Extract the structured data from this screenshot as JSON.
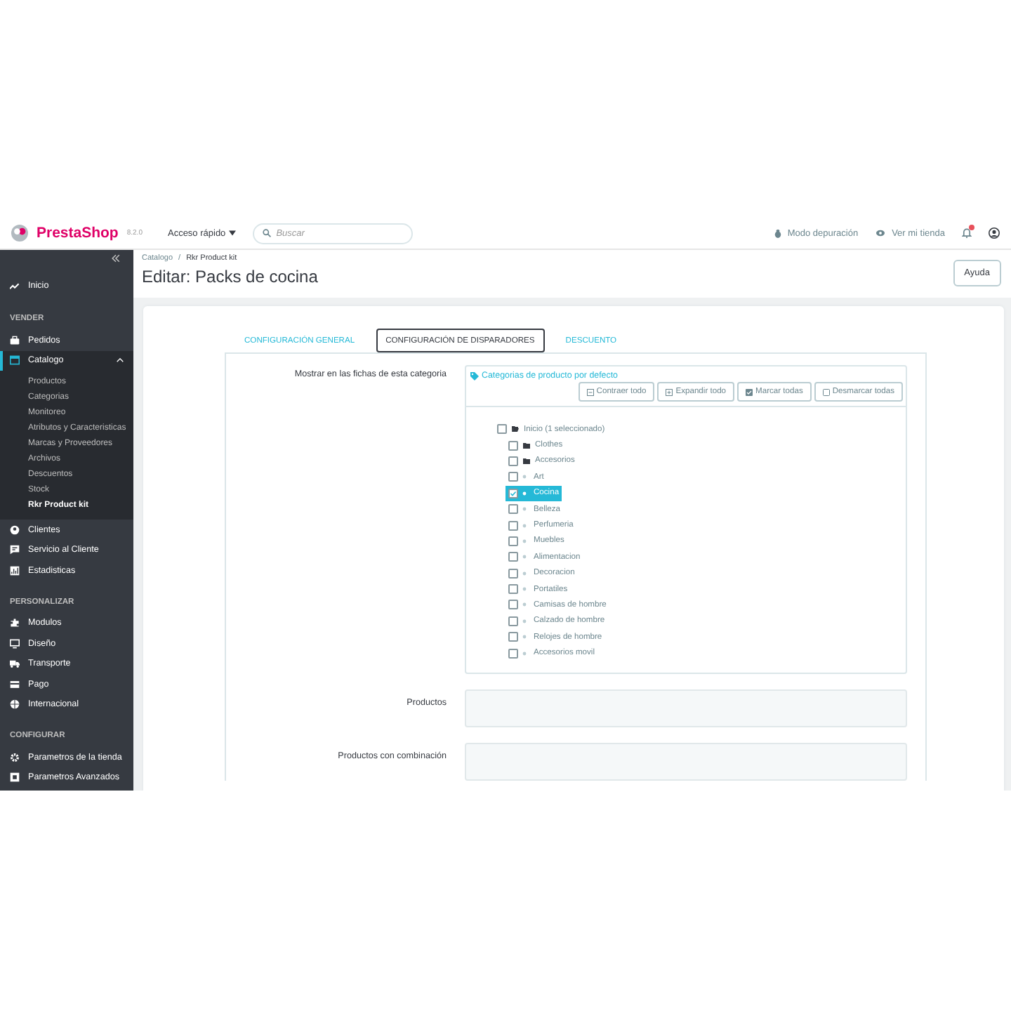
{
  "header": {
    "logo": "PrestaShop",
    "version": "8.2.0",
    "quick_access": "Acceso rápido",
    "search": {
      "placeholder": "Buscar"
    },
    "debug": "Modo depuración",
    "view_shop": "Ver mi tienda",
    "notifications": {
      "unread": true
    }
  },
  "sidebar": {
    "items": [
      {
        "kind": "link",
        "label": "Inicio",
        "selected": false
      },
      {
        "kind": "section",
        "label": "VENDER"
      },
      {
        "kind": "link",
        "label": "Pedidos",
        "selected": false
      },
      {
        "kind": "link",
        "label": "Catalogo",
        "selected": true,
        "expanded": true,
        "children": [
          {
            "label": "Productos",
            "selected": false
          },
          {
            "label": "Categorias",
            "selected": false
          },
          {
            "label": "Monitoreo",
            "selected": false
          },
          {
            "label": "Atributos y Caracteristicas",
            "selected": false
          },
          {
            "label": "Marcas y Proveedores",
            "selected": false
          },
          {
            "label": "Archivos",
            "selected": false
          },
          {
            "label": "Descuentos",
            "selected": false
          },
          {
            "label": "Stock",
            "selected": false
          },
          {
            "label": "Rkr Product kit",
            "selected": true
          }
        ]
      },
      {
        "kind": "link",
        "label": "Clientes",
        "selected": false
      },
      {
        "kind": "link",
        "label": "Servicio al Cliente",
        "selected": false
      },
      {
        "kind": "link",
        "label": "Estadisticas",
        "selected": false
      },
      {
        "kind": "section",
        "label": "PERSONALIZAR"
      },
      {
        "kind": "link",
        "label": "Modulos",
        "selected": false
      },
      {
        "kind": "link",
        "label": "Diseño",
        "selected": false
      },
      {
        "kind": "link",
        "label": "Transporte",
        "selected": false
      },
      {
        "kind": "link",
        "label": "Pago",
        "selected": false
      },
      {
        "kind": "link",
        "label": "Internacional",
        "selected": false
      },
      {
        "kind": "section",
        "label": "CONFIGURAR"
      },
      {
        "kind": "link",
        "label": "Parametros de la tienda",
        "selected": false
      },
      {
        "kind": "link",
        "label": "Parametros Avanzados",
        "selected": false
      }
    ]
  },
  "breadcrumb": {
    "items": [
      "Catalogo",
      "Rkr Product kit"
    ],
    "separator": "/"
  },
  "title": "Editar: Packs de cocina",
  "help_button": "Ayuda",
  "tabs": [
    {
      "label": "CONFIGURACIÓN GENERAL",
      "selected": false
    },
    {
      "label": "CONFIGURACIÓN DE DISPARADORES",
      "selected": true
    },
    {
      "label": "DESCUENTO",
      "selected": false
    }
  ],
  "category_field": {
    "label": "Mostrar en las fichas de esta categoria",
    "tree_title": "Categorias de producto por defecto",
    "buttons": [
      {
        "kind": "collapse",
        "label": "Contraer todo"
      },
      {
        "kind": "expand",
        "label": "Expandir todo"
      },
      {
        "kind": "check",
        "label": "Marcar todas"
      },
      {
        "kind": "uncheck",
        "label": "Desmarcar todas"
      }
    ],
    "tree": [
      {
        "kind": "folder-open",
        "label": "Inicio (1 seleccionado)",
        "checked": false,
        "children": [
          {
            "kind": "folder",
            "label": "Clothes",
            "checked": false
          },
          {
            "kind": "folder",
            "label": "Accesorios",
            "checked": false
          },
          {
            "kind": "leaf",
            "label": "Art",
            "checked": false
          },
          {
            "kind": "leaf",
            "label": "Cocina",
            "checked": true
          },
          {
            "kind": "leaf",
            "label": "Belleza",
            "checked": false
          },
          {
            "kind": "leaf",
            "label": "Perfumeria",
            "checked": false
          },
          {
            "kind": "leaf",
            "label": "Muebles",
            "checked": false
          },
          {
            "kind": "leaf",
            "label": "Alimentacion",
            "checked": false
          },
          {
            "kind": "leaf",
            "label": "Decoracion",
            "checked": false
          },
          {
            "kind": "leaf",
            "label": "Portatiles",
            "checked": false
          },
          {
            "kind": "leaf",
            "label": "Camisas de hombre",
            "checked": false
          },
          {
            "kind": "leaf",
            "label": "Calzado de hombre",
            "checked": false
          },
          {
            "kind": "leaf",
            "label": "Relojes de hombre",
            "checked": false
          },
          {
            "kind": "leaf",
            "label": "Accesorios movil",
            "checked": false
          }
        ]
      }
    ]
  },
  "fields": [
    {
      "label": "Productos"
    },
    {
      "label": "Productos con combinación"
    }
  ]
}
